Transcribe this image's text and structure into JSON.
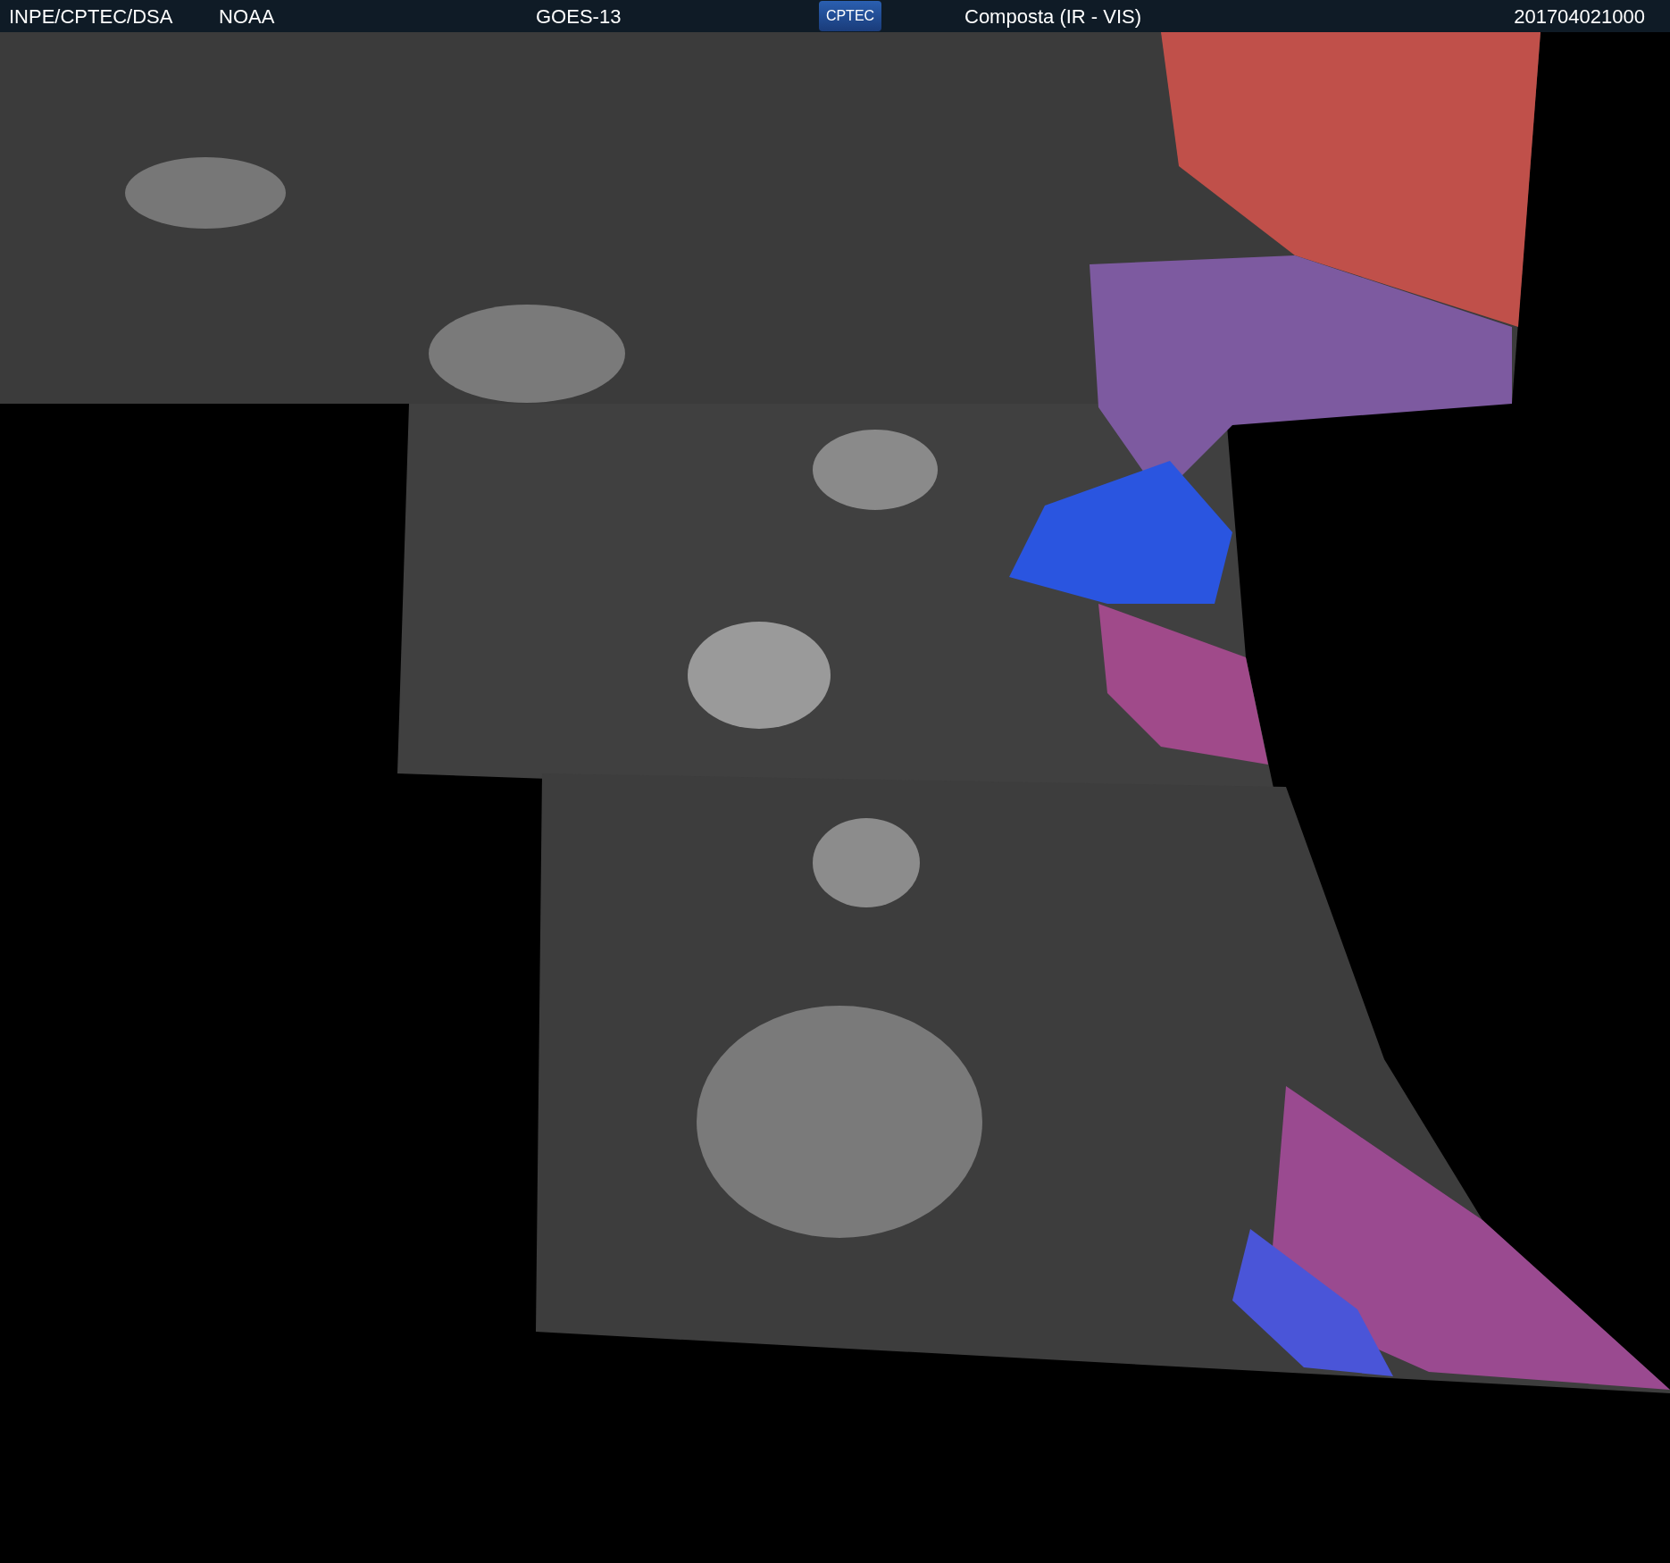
{
  "header": {
    "source": "INPE/CPTEC/DSA",
    "agency": "NOAA",
    "satellite": "GOES-13",
    "logo": "CPTEC",
    "product": "Composta (IR - VIS)",
    "timestamp": "201704021000"
  }
}
